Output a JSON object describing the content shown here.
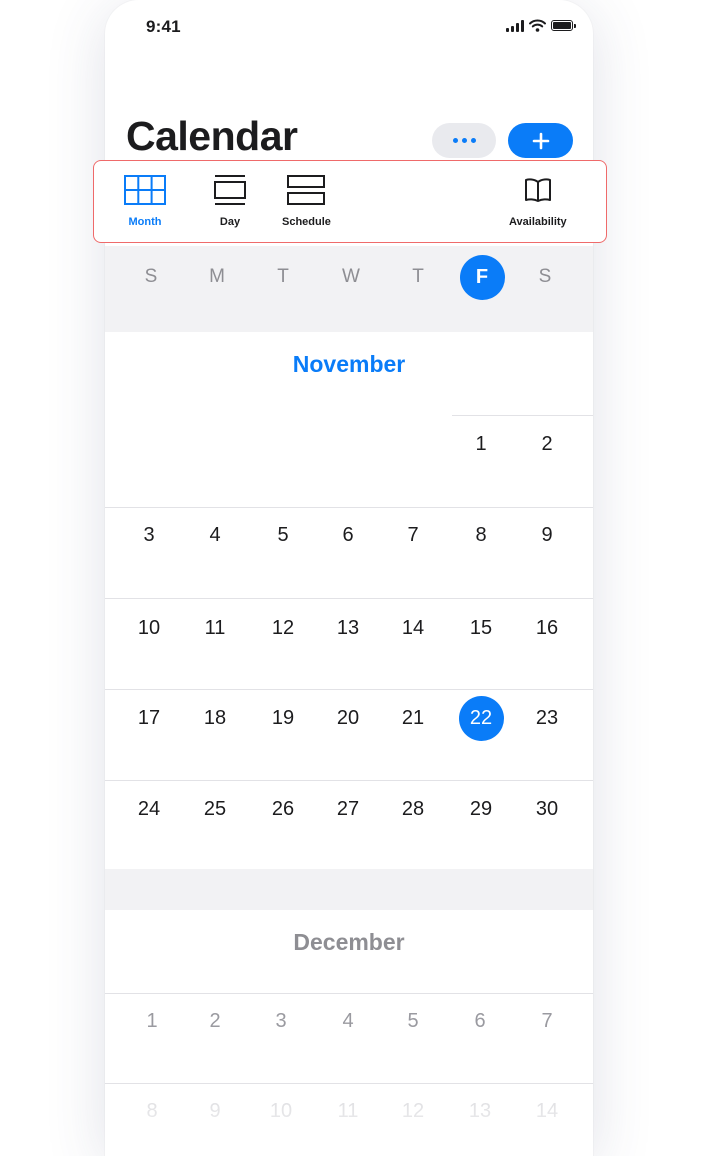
{
  "status_bar": {
    "time": "9:41"
  },
  "header": {
    "title": "Calendar"
  },
  "views": [
    {
      "label": "Month",
      "icon": "month-grid-icon",
      "active": true
    },
    {
      "label": "Day",
      "icon": "day-view-icon",
      "active": false
    },
    {
      "label": "Schedule",
      "icon": "schedule-view-icon",
      "active": false
    },
    {
      "label": "Availability",
      "icon": "book-icon",
      "active": false
    }
  ],
  "weekdays": [
    "S",
    "M",
    "T",
    "W",
    "T",
    "F",
    "S"
  ],
  "today_weekday_index": 5,
  "november": {
    "name": "November",
    "weeks": [
      [
        "",
        "",
        "",
        "",
        "",
        "1",
        "2"
      ],
      [
        "3",
        "4",
        "5",
        "6",
        "7",
        "8",
        "9"
      ],
      [
        "10",
        "11",
        "12",
        "13",
        "14",
        "15",
        "16"
      ],
      [
        "17",
        "18",
        "19",
        "20",
        "21",
        "22",
        "23"
      ],
      [
        "24",
        "25",
        "26",
        "27",
        "28",
        "29",
        "30"
      ]
    ],
    "today": "22"
  },
  "december": {
    "name": "December",
    "weeks": [
      [
        "1",
        "2",
        "3",
        "4",
        "5",
        "6",
        "7"
      ],
      [
        "8",
        "9",
        "10",
        "11",
        "12",
        "13",
        "14"
      ]
    ]
  },
  "colors": {
    "accent": "#0a7cf8",
    "highlight_border": "#ef6a6a",
    "muted_text": "#8e8e93",
    "band": "#f2f2f4"
  }
}
